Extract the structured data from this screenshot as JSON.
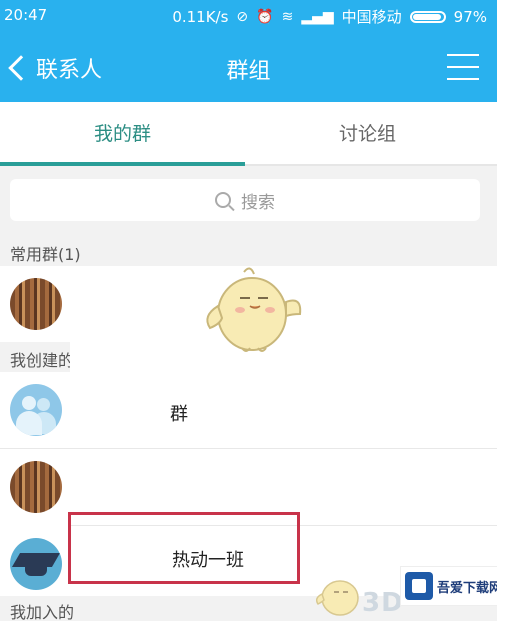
{
  "status_bar": {
    "time": "20:47",
    "speed": "0.11K/s",
    "carrier": "中国移动",
    "battery": "97%"
  },
  "nav": {
    "back_label": "联系人",
    "title": "群组"
  },
  "tabs": [
    {
      "label": "我的群",
      "active": true
    },
    {
      "label": "讨论组",
      "active": false
    }
  ],
  "search": {
    "placeholder": "搜索"
  },
  "sections": {
    "frequent": "常用群(1)",
    "created": "我创建的",
    "joined": "我加入的"
  },
  "groups": {
    "created_item_partial": "群",
    "highlighted_item": "热动一班"
  },
  "watermark": {
    "brand": "吾爱下载网",
    "mark": "3D"
  },
  "colors": {
    "header_bg": "#29b1ee",
    "tab_active": "#2a9e98",
    "highlight_border": "#c8334a"
  }
}
